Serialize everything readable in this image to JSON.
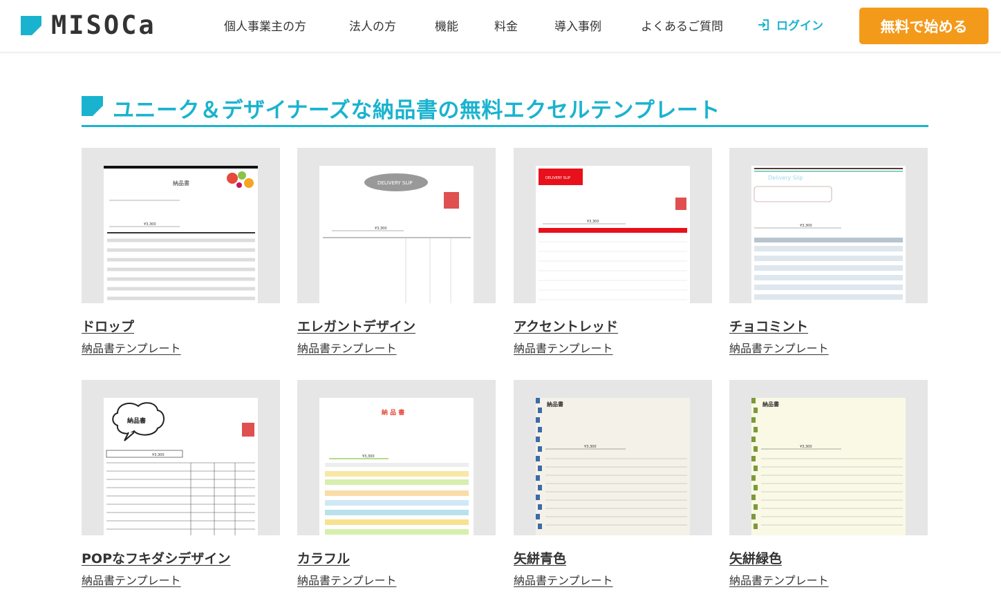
{
  "header": {
    "logo_text": "MISOCa",
    "nav": [
      {
        "label": "個人事業主の方"
      },
      {
        "label": "法人の方"
      },
      {
        "label": "機能"
      },
      {
        "label": "料金"
      },
      {
        "label": "導入事例"
      },
      {
        "label": "よくあるご質問"
      }
    ],
    "login_label": "ログイン",
    "cta_label": "無料で始める",
    "accent_color": "#1ab3cf",
    "cta_color": "#f39a1b"
  },
  "section": {
    "title": "ユニーク＆デザイナーズな納品書の無料エクセルテンプレート"
  },
  "cards": [
    {
      "title": "ドロップ",
      "subtitle": "納品書テンプレート",
      "thumb_label": "納品書",
      "total": "¥3,300"
    },
    {
      "title": "エレガントデザイン",
      "subtitle": "納品書テンプレート",
      "thumb_label": "DELIVERY SLIP",
      "total": "¥3,300"
    },
    {
      "title": "アクセントレッド",
      "subtitle": "納品書テンプレート",
      "thumb_label": "DELIVERY SLIP",
      "total": "¥3,300"
    },
    {
      "title": "チョコミント",
      "subtitle": "納品書テンプレート",
      "thumb_label": "Delivery Slip",
      "total": "¥3,300"
    },
    {
      "title": "POPなフキダシデザイン",
      "subtitle": "納品書テンプレート",
      "thumb_label": "納品書",
      "total": "¥3,300"
    },
    {
      "title": "カラフル",
      "subtitle": "納品書テンプレート",
      "thumb_label": "納 品 書",
      "total": "¥3,300"
    },
    {
      "title": "矢絣青色",
      "subtitle": "納品書テンプレート",
      "thumb_label": "納品書",
      "total": "¥3,300"
    },
    {
      "title": "矢絣緑色",
      "subtitle": "納品書テンプレート",
      "thumb_label": "納品書",
      "total": "¥3,300"
    }
  ]
}
